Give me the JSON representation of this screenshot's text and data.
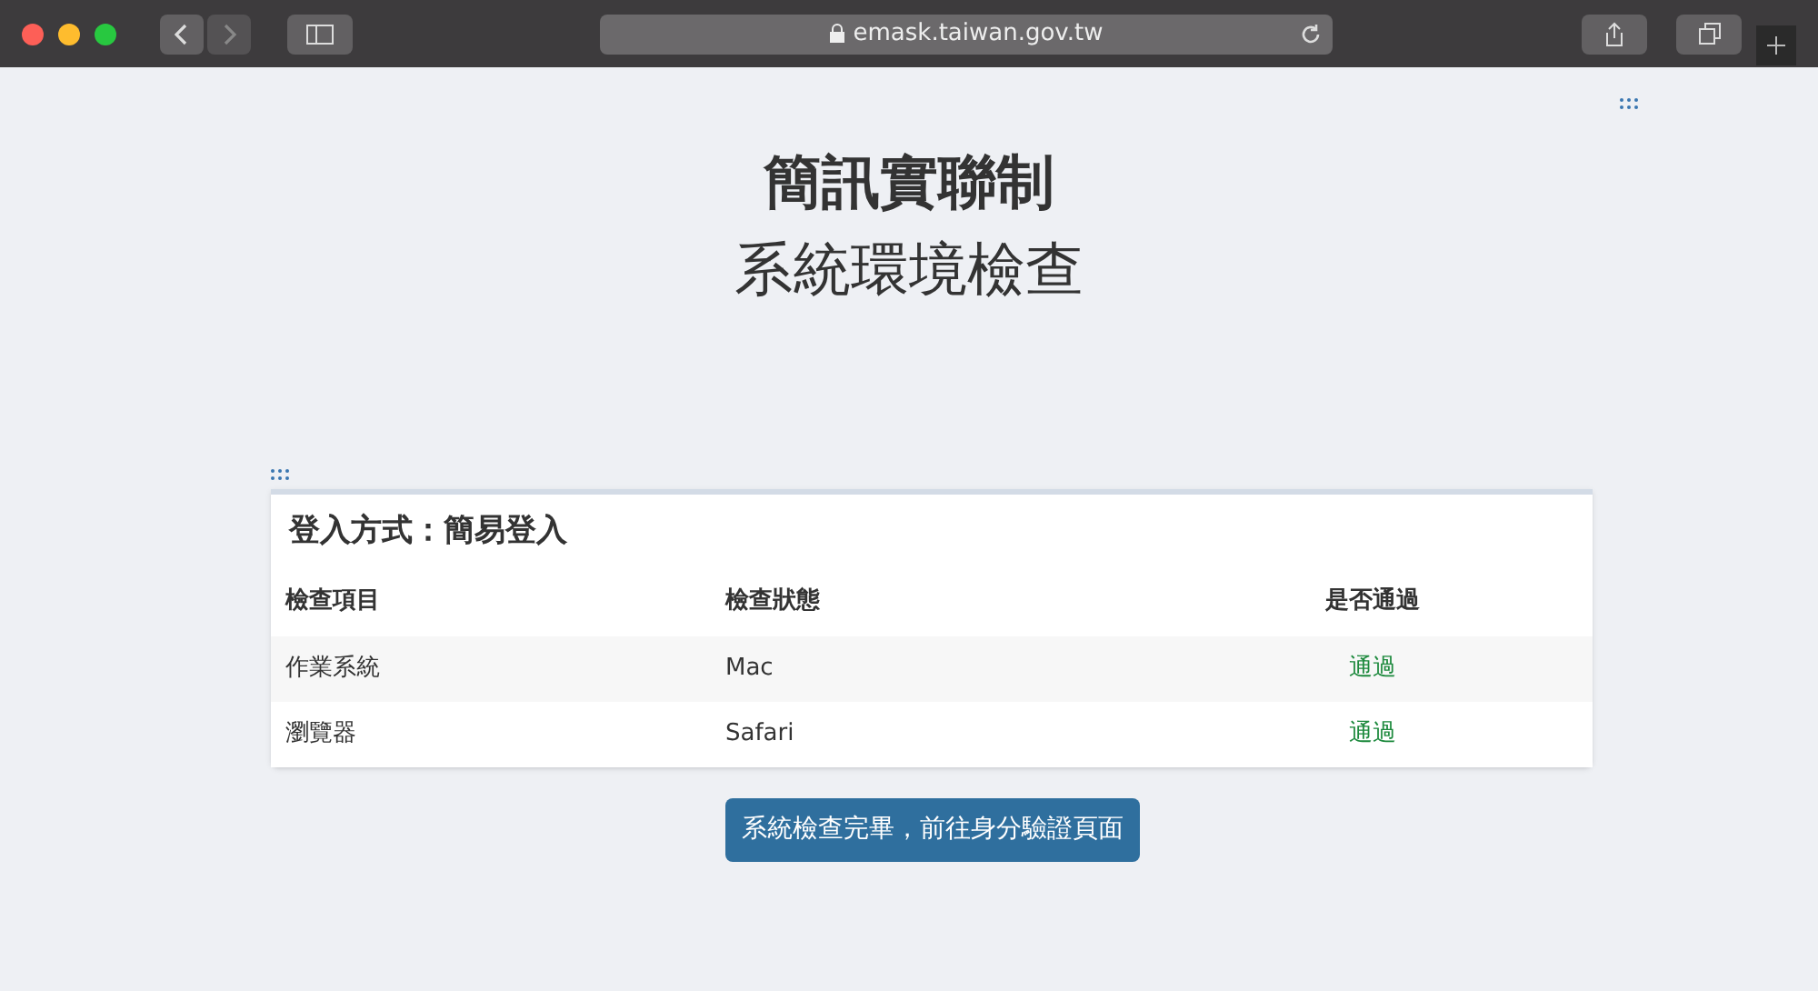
{
  "browser": {
    "url": "emask.taiwan.gov.tw"
  },
  "heading": {
    "title": "簡訊實聯制",
    "subtitle": "系統環境檢查"
  },
  "card": {
    "title": "登入方式：簡易登入",
    "columns": [
      "檢查項目",
      "檢查狀態",
      "是否通過"
    ],
    "rows": [
      {
        "item": "作業系統",
        "status": "Mac",
        "result": "通過",
        "passed": true
      },
      {
        "item": "瀏覽器",
        "status": "Safari",
        "result": "通過",
        "passed": true
      }
    ]
  },
  "button": "系統檢查完畢，前往身分驗證頁面"
}
